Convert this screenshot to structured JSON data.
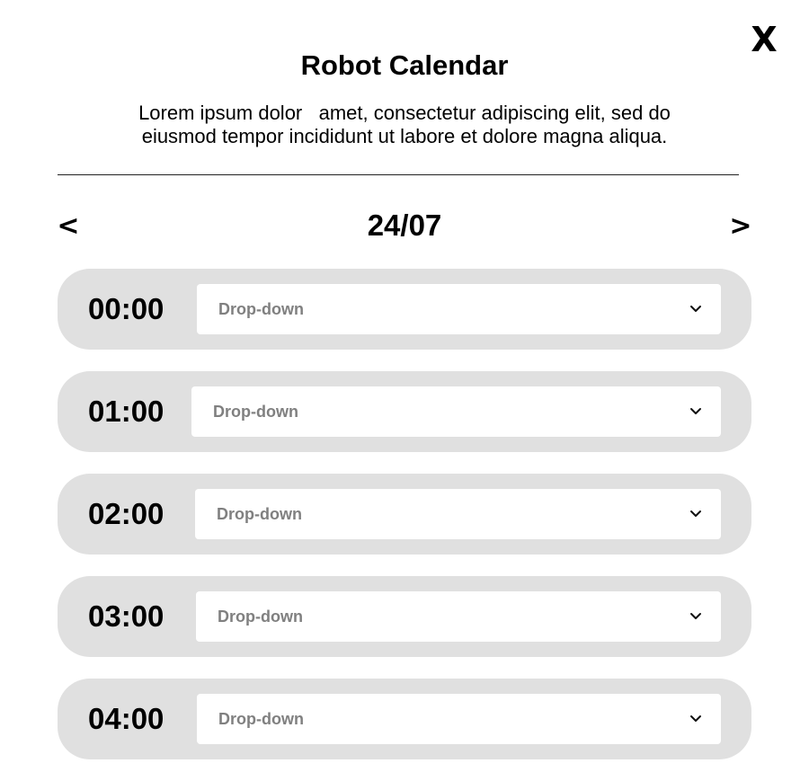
{
  "dialog": {
    "close_label": "X",
    "title": "Robot Calendar",
    "description": "Lorem ipsum dolor   amet, consectetur adipiscing elit, sed do\neiusmod tempor incididunt ut labore et dolore magna aliqua."
  },
  "navigation": {
    "prev_label": "<",
    "next_label": ">",
    "date": "24/07"
  },
  "slots": [
    {
      "time": "00:00",
      "dropdown_value": "Drop-down",
      "dropdown_icon": "chevron-down-icon"
    },
    {
      "time": "01:00",
      "dropdown_value": "Drop-down",
      "dropdown_icon": "chevron-down-icon"
    },
    {
      "time": "02:00",
      "dropdown_value": "Drop-down",
      "dropdown_icon": "chevron-down-icon"
    },
    {
      "time": "03:00",
      "dropdown_value": "Drop-down",
      "dropdown_icon": "chevron-down-icon"
    },
    {
      "time": "04:00",
      "dropdown_value": "Drop-down",
      "dropdown_icon": "chevron-down-icon"
    }
  ],
  "colors": {
    "slot_background": "#e0e0e0",
    "dropdown_background": "#ffffff",
    "dropdown_text": "#808080",
    "text": "#000000"
  }
}
